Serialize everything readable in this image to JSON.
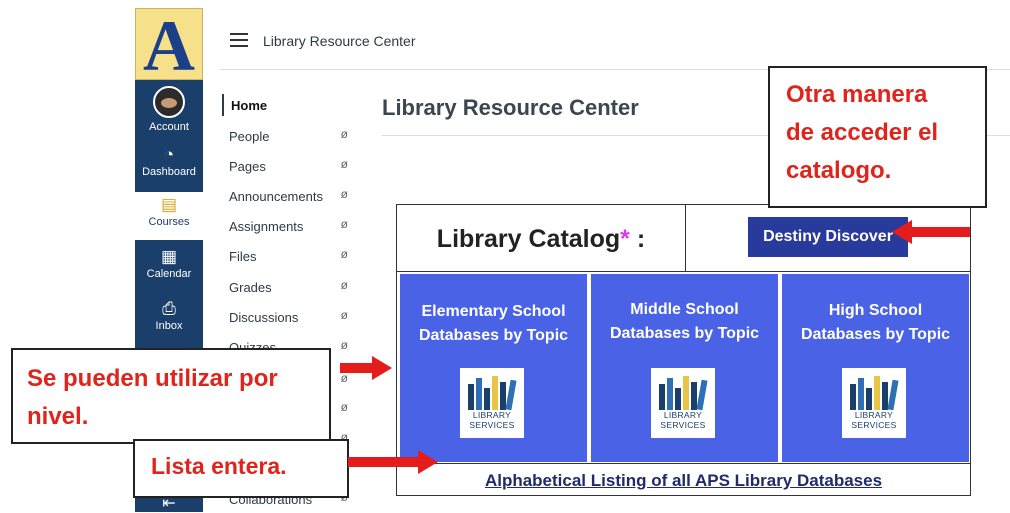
{
  "global_nav": {
    "logo_letter": "A",
    "items": [
      {
        "label": "Account",
        "icon": "avatar"
      },
      {
        "label": "Dashboard",
        "icon": "speedometer-icon"
      },
      {
        "label": "Courses",
        "icon": "book-icon"
      },
      {
        "label": "Calendar",
        "icon": "calendar-icon"
      },
      {
        "label": "Inbox",
        "icon": "inbox-icon"
      }
    ],
    "collapse_icon": "collapse-left-icon"
  },
  "header": {
    "menu_icon": "hamburger-icon",
    "breadcrumb": "Library Resource Center"
  },
  "course_nav": {
    "items": [
      {
        "label": "Home"
      },
      {
        "label": "People"
      },
      {
        "label": "Pages"
      },
      {
        "label": "Announcements"
      },
      {
        "label": "Assignments"
      },
      {
        "label": "Files"
      },
      {
        "label": "Grades"
      },
      {
        "label": "Discussions"
      },
      {
        "label": "Quizzes"
      },
      {
        "label": "Collaborations"
      }
    ],
    "eye_glyph": "ø"
  },
  "main": {
    "page_title": "Library Resource Center",
    "catalog_label": "Library Catalog",
    "catalog_star": "*",
    "catalog_colon": " :",
    "destiny_button": "Destiny Discover",
    "tiles": [
      {
        "line1": "Elementary School",
        "line2": "Databases by Topic"
      },
      {
        "line1": "Middle School",
        "line2": "Databases by Topic"
      },
      {
        "line1": "High School",
        "line2": "Databases by Topic"
      }
    ],
    "library_logo_line1": "LIBRARY",
    "library_logo_line2": "SERVICES",
    "alpha_link": "Alphabetical Listing of all APS Library Databases"
  },
  "annotations": {
    "note1_line1": "Otra manera",
    "note1_line2": "de acceder el",
    "note1_line3": "catalogo.",
    "note2_line1": "Se pueden utilizar por",
    "note2_line2": "nivel.",
    "note3": "Lista entera."
  },
  "colors": {
    "nav_bg": "#1a3f6b",
    "tile_bg": "#4a63e6",
    "destiny_bg": "#283a9b",
    "annotation_red": "#e0241b"
  }
}
